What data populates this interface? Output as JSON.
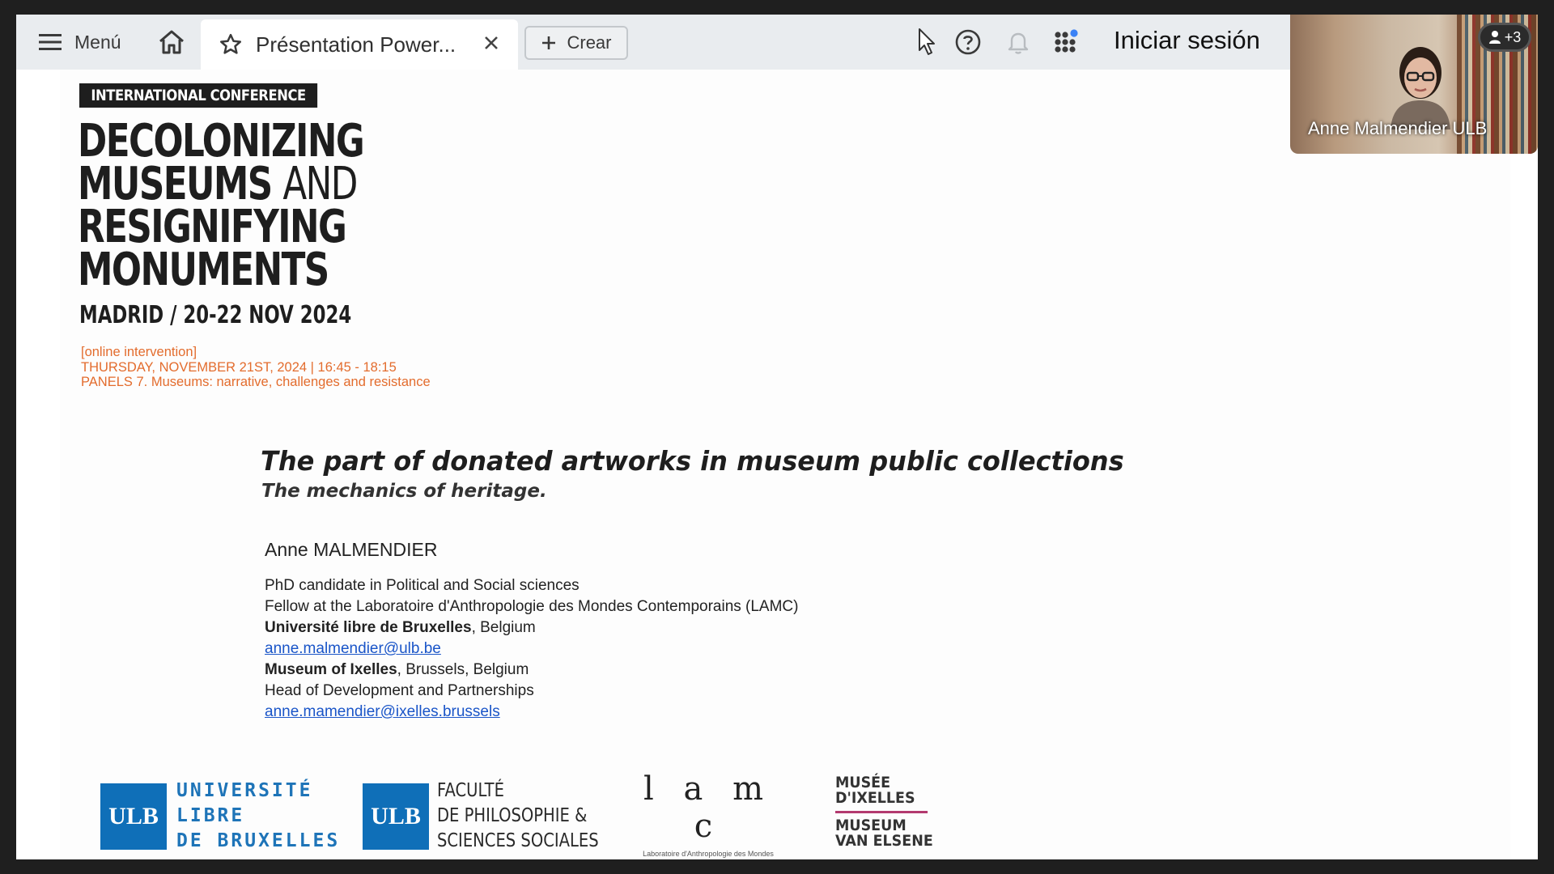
{
  "toolbar": {
    "menu_label": "Menú",
    "tab_title": "Présentation Power...",
    "create_label": "Crear",
    "signin_label": "Iniciar sesión"
  },
  "video": {
    "participant_name": "Anne Malmendier ULB",
    "extra_participants": "+3"
  },
  "slide": {
    "badge": "INTERNATIONAL CONFERENCE",
    "title_lines": [
      "DECOLONIZING",
      "MUSEUMS",
      "AND",
      "RESIGNIFYING",
      "MONUMENTS"
    ],
    "date_line": "MADRID / 20-22 NOV 2024",
    "session": {
      "line1": "[online intervention]",
      "line2": "THURSDAY, NOVEMBER 21ST, 2024 | 16:45 - 18:15",
      "line3": "PANELS 7. Museums: narrative, challenges and resistance"
    },
    "talk_title": "The part of donated artworks in  museum public collections",
    "talk_subtitle": "The mechanics of heritage.",
    "author": "Anne MALMENDIER",
    "affiliation": {
      "line1": "PhD candidate in Political and Social sciences",
      "line2": "Fellow at the Laboratoire d'Anthropologie des Mondes Contemporains (LAMC)",
      "line3_bold": "Université libre de Bruxelles",
      "line3_rest": ", Belgium",
      "email1": "anne.malmendier@ulb.be",
      "line5_bold": "Museum of Ixelles",
      "line5_rest": ", Brussels, Belgium",
      "line6": "Head of Development and Partnerships",
      "email2": "anne.mamendier@ixelles.brussels"
    },
    "logos": {
      "ulb_mark": "ULB",
      "ulb1_lines": [
        "UNIVERSITÉ",
        "LIBRE",
        "DE BRUXELLES"
      ],
      "ulb2_lines": [
        "FACULTÉ",
        "DE PHILOSOPHIE &",
        "SCIENCES SOCIALES"
      ],
      "lamc_mark": "l a m c",
      "lamc_sub": "Laboratoire d'Anthropologie des Mondes Contemporains",
      "museum_top": [
        "MUSÉE",
        "D'IXELLES"
      ],
      "museum_bottom": [
        "MUSEUM",
        "VAN ELSENE"
      ]
    }
  },
  "colors": {
    "accent_orange": "#e36c2d",
    "ulb_blue": "#0f6fb8",
    "link_blue": "#1a55c8",
    "museum_rule": "#b33a6f"
  }
}
